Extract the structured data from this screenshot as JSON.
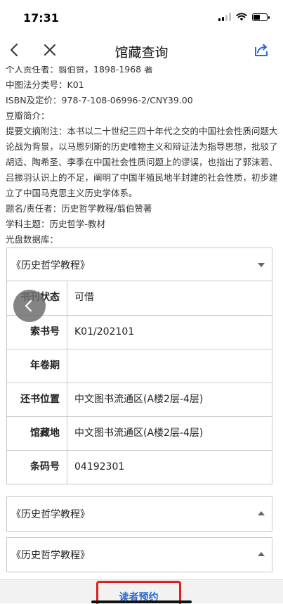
{
  "status_bar": {
    "time": "17:31"
  },
  "nav": {
    "title": "馆藏查询"
  },
  "book_info": {
    "lines": [
      "个人责任者：翦伯赞，1898-1968 著",
      "中图法分类号：K01",
      "ISBN及定价：978-7-108-06996-2/CNY39.00",
      "豆瓣简介：",
      "提要文摘附注：本书以二十世纪三四十年代之交的中国社会性质问题大论战为背景，以马恩列斯的历史唯物主义和辩证法为指导思想，批驳了胡适、陶希圣、李季在中国社会性质问题上的谬误，也指出了郭沫若、吕振羽认识上的不足，阐明了中国半殖民地半封建的社会性质，初步建立了中国马克思主义历史学体系。",
      "题名/责任者：历史哲学教程/翦伯赞著",
      "学科主题：历史哲学-教材",
      "光盘数据库："
    ]
  },
  "holdings": [
    {
      "title": "《历史哲学教程》",
      "expanded": true
    },
    {
      "title": "《历史哲学教程》",
      "expanded": false
    },
    {
      "title": "《历史哲学教程》",
      "expanded": false
    }
  ],
  "detail_table": [
    {
      "label": "书刊状态",
      "value": "可借"
    },
    {
      "label": "索书号",
      "value": "K01/202101"
    },
    {
      "label": "年卷期",
      "value": ""
    },
    {
      "label": "还书位置",
      "value": "中文图书流通区(A楼2层-4层)"
    },
    {
      "label": "馆藏地",
      "value": "中文图书流通区(A楼2层-4层)"
    },
    {
      "label": "条码号",
      "value": "04192301"
    }
  ],
  "footer": {
    "reserve_label": "读者预约"
  },
  "icons": {
    "back": "chevron-left-icon",
    "close": "close-icon",
    "share": "share-icon",
    "float_back": "chevron-left-icon"
  },
  "colors": {
    "accent": "#2a6ad3",
    "highlight_box": "#e02020"
  }
}
